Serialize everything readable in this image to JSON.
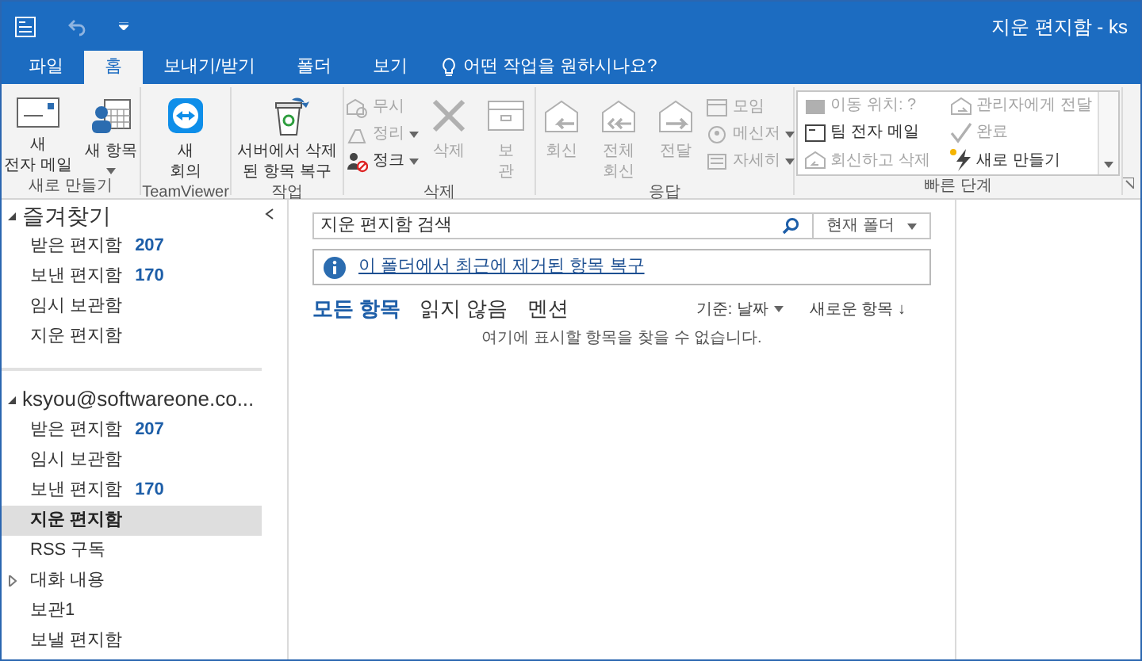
{
  "window": {
    "title": "지운 편지함 - ks"
  },
  "tabs": [
    {
      "label": "파일",
      "selected": false
    },
    {
      "label": "홈",
      "selected": true
    },
    {
      "label": "보내기/받기",
      "selected": false
    },
    {
      "label": "폴더",
      "selected": false
    },
    {
      "label": "보기",
      "selected": false
    }
  ],
  "tell_me": "어떤 작업을 원하시나요?",
  "ribbon": [
    {
      "label": "새로 만들기",
      "items": [
        {
          "kind": "large",
          "lines": [
            "새",
            "전자 메일"
          ],
          "menu": false,
          "disabled": false
        },
        {
          "kind": "large",
          "lines": [
            "새 항목"
          ],
          "menu": true,
          "disabled": false
        }
      ]
    },
    {
      "label": "TeamViewer",
      "items": [
        {
          "kind": "large",
          "lines": [
            "새",
            "회의"
          ],
          "menu": false,
          "disabled": false
        }
      ]
    },
    {
      "label": "작업",
      "items": [
        {
          "kind": "large",
          "lines": [
            "서버에서 삭제",
            "된 항목 복구"
          ],
          "menu": false,
          "disabled": false
        }
      ]
    },
    {
      "label": "삭제",
      "items": [
        {
          "kind": "small",
          "lines": [
            "무시"
          ],
          "menu": false,
          "disabled": true
        },
        {
          "kind": "small",
          "lines": [
            "정리"
          ],
          "menu": true,
          "disabled": true
        },
        {
          "kind": "small",
          "lines": [
            "정크"
          ],
          "menu": true,
          "disabled": false
        },
        {
          "kind": "large",
          "lines": [
            "삭제"
          ],
          "menu": false,
          "disabled": true
        },
        {
          "kind": "large",
          "lines": [
            "보",
            "관"
          ],
          "menu": false,
          "disabled": true
        }
      ]
    },
    {
      "label": "응답",
      "items": [
        {
          "kind": "large",
          "lines": [
            "회신"
          ],
          "menu": false,
          "disabled": true
        },
        {
          "kind": "large",
          "lines": [
            "전체",
            "회신"
          ],
          "menu": false,
          "disabled": true
        },
        {
          "kind": "large",
          "lines": [
            "전달"
          ],
          "menu": false,
          "disabled": true
        },
        {
          "kind": "small",
          "lines": [
            "모임"
          ],
          "menu": false,
          "disabled": true
        },
        {
          "kind": "small",
          "lines": [
            "메신저"
          ],
          "menu": true,
          "disabled": true
        },
        {
          "kind": "small",
          "lines": [
            "자세히"
          ],
          "menu": true,
          "disabled": true
        }
      ]
    },
    {
      "label": "빠른 단계",
      "items": [
        {
          "kind": "quick",
          "lines": [
            "이동 위치: ?"
          ],
          "menu": false,
          "disabled": true
        },
        {
          "kind": "quick",
          "lines": [
            "팀 전자 메일"
          ],
          "menu": false,
          "disabled": false
        },
        {
          "kind": "quick",
          "lines": [
            "회신하고 삭제"
          ],
          "menu": false,
          "disabled": true
        },
        {
          "kind": "quick",
          "lines": [
            "관리자에게 전달"
          ],
          "menu": false,
          "disabled": true
        },
        {
          "kind": "quick",
          "lines": [
            "완료"
          ],
          "menu": false,
          "disabled": true
        },
        {
          "kind": "quick",
          "lines": [
            "새로 만들기"
          ],
          "menu": false,
          "disabled": false
        }
      ]
    }
  ],
  "nav": [
    {
      "title": "즐겨찾기",
      "folders": [
        {
          "label": "받은 편지함",
          "count": "207",
          "kind": "folder",
          "selected": false
        },
        {
          "label": "보낸 편지함",
          "count": "170",
          "kind": "folder",
          "selected": false
        },
        {
          "label": "임시 보관함",
          "kind": "folder",
          "selected": false
        },
        {
          "label": "지운 편지함",
          "kind": "folder",
          "selected": false
        }
      ]
    },
    {
      "title": "ksyou@softwareone.co...",
      "folders": [
        {
          "label": "받은 편지함",
          "count": "207",
          "kind": "folder",
          "selected": false
        },
        {
          "label": "임시 보관함",
          "kind": "folder",
          "selected": false
        },
        {
          "label": "보낸 편지함",
          "count": "170",
          "kind": "folder",
          "selected": false
        },
        {
          "label": "지운 편지함",
          "kind": "folder",
          "selected": true
        },
        {
          "label": "RSS 구독",
          "kind": "folder",
          "selected": false
        },
        {
          "label": "대화 내용",
          "kind": "collapsed",
          "selected": false
        },
        {
          "label": "보관1",
          "kind": "folder",
          "selected": false
        },
        {
          "label": "보낼 편지함",
          "kind": "folder",
          "selected": false
        }
      ]
    }
  ],
  "search": {
    "placeholder": "지운 편지함 검색",
    "scope": "현재 폴더"
  },
  "info_link": "이 폴더에서 최근에 제거된 항목 복구",
  "filters": [
    {
      "label": "모든 항목",
      "selected": true
    },
    {
      "label": "읽지 않음",
      "selected": false
    },
    {
      "label": "멘션",
      "selected": false
    }
  ],
  "sort": {
    "by": "기준: 날짜",
    "order": "새로운 항목 ↓"
  },
  "empty_message": "여기에 표시할 항목을 찾을 수 없습니다."
}
